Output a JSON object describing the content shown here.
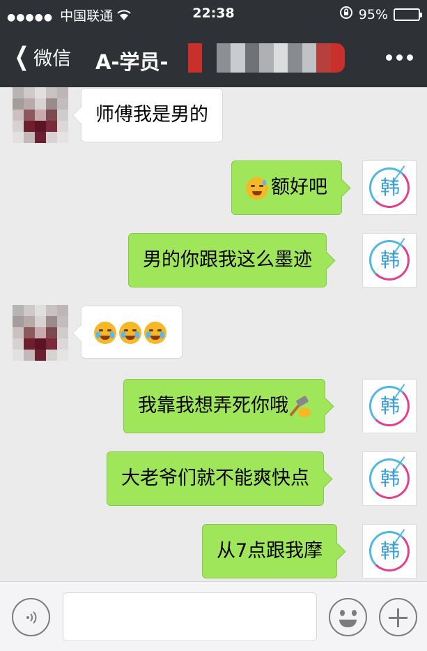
{
  "status_bar": {
    "signal_dots": "●●●●●",
    "carrier": "中国联通",
    "wifi_icon": "wifi-icon",
    "time": "22:38",
    "lock_icon": "rotation-lock-icon",
    "battery_text": "95%",
    "battery_level": 0.95
  },
  "nav": {
    "back_label": "微信",
    "title": "A-学员-",
    "more_icon": "more-icon"
  },
  "messages": [
    {
      "side": "in",
      "text": "师傅我是男的"
    },
    {
      "side": "out",
      "emoji": "smirk-sweat-emoji",
      "text": "额好吧"
    },
    {
      "side": "out",
      "text": "男的你跟我这么墨迹"
    },
    {
      "side": "in",
      "emoji": "loudly-crying-emoji",
      "emoji_count": 3
    },
    {
      "side": "out",
      "text": "我靠我想弄死你哦",
      "emoji": "hammer-emoji"
    },
    {
      "side": "out",
      "text": "大老爷们就不能爽快点"
    },
    {
      "side": "out",
      "text": "从7点跟我摩"
    }
  ],
  "self_avatar": {
    "character": "韩"
  },
  "input_bar": {
    "voice_icon": "voice-icon",
    "emoji_icon": "emoji-icon",
    "plus_icon": "plus-icon",
    "placeholder": ""
  },
  "colors": {
    "header_bg": "#2e3135",
    "chat_bg": "#ebebeb",
    "out_bubble": "#9fe65a",
    "in_bubble": "#ffffff"
  }
}
